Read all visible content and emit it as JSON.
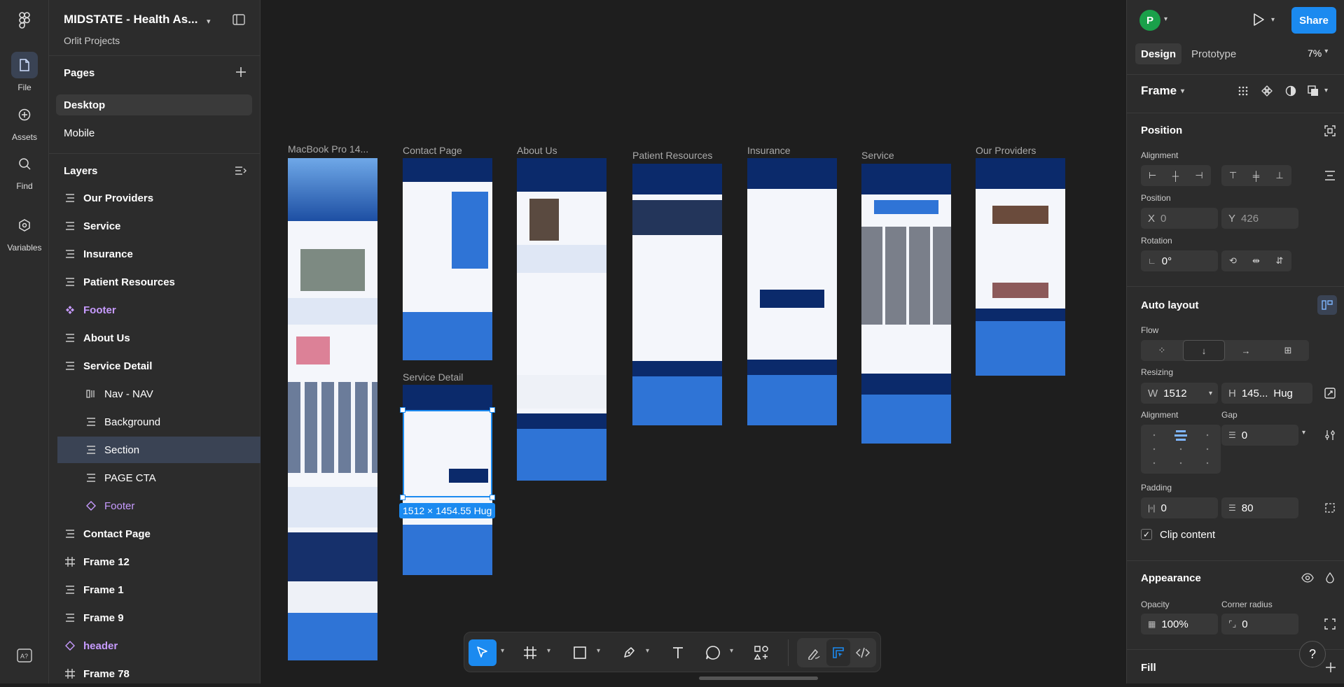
{
  "rail": {
    "file": "File",
    "assets": "Assets",
    "find": "Find",
    "variables": "Variables"
  },
  "project": {
    "title": "MIDSTATE - Health As...",
    "subtitle": "Orlit Projects"
  },
  "pages": {
    "title": "Pages",
    "items": [
      "Desktop",
      "Mobile"
    ]
  },
  "layers": {
    "title": "Layers",
    "items": [
      "Our Providers",
      "Service",
      "Insurance",
      "Patient Resources",
      "Footer",
      "About Us",
      "Service Detail",
      "Nav - NAV",
      "Background",
      "Section",
      "PAGE CTA",
      "Footer",
      "Contact Page",
      "Frame 12",
      "Frame 1",
      "Frame 9",
      "header",
      "Frame 78"
    ]
  },
  "canvas": {
    "frames": [
      "MacBook Pro 14...",
      "Contact Page",
      "About Us",
      "Patient Resources",
      "Insurance",
      "Service",
      "Our Providers",
      "Service Detail"
    ],
    "selection_badge": "1512 × 1454.55 Hug"
  },
  "right": {
    "avatar": "P",
    "share": "Share",
    "tab_design": "Design",
    "tab_prototype": "Prototype",
    "zoom": "7%",
    "frame_label": "Frame",
    "position_title": "Position",
    "alignment_label": "Alignment",
    "position_label": "Position",
    "x_label": "X",
    "x_value": "0",
    "y_label": "Y",
    "y_value": "426",
    "rotation_label": "Rotation",
    "rotation_value": "0°",
    "autolayout_title": "Auto layout",
    "flow_label": "Flow",
    "resizing_label": "Resizing",
    "w_label": "W",
    "w_value": "1512",
    "h_label": "H",
    "h_value": "145...",
    "h_mode": "Hug",
    "alignment2_label": "Alignment",
    "gap_label": "Gap",
    "gap_value": "0",
    "padding_label": "Padding",
    "padding_h": "0",
    "padding_v": "80",
    "clip_label": "Clip content",
    "appearance_title": "Appearance",
    "opacity_label": "Opacity",
    "opacity_value": "100%",
    "corner_label": "Corner radius",
    "corner_value": "0",
    "fill_title": "Fill"
  },
  "colors": {
    "accent": "#1b8af0",
    "frame_navy": "#0b2a6b",
    "frame_blue": "#2f74d6"
  }
}
